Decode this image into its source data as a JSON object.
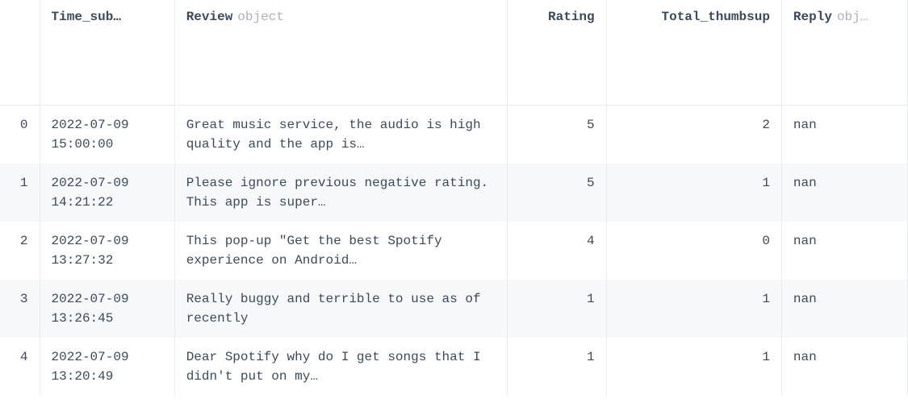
{
  "table": {
    "columns": [
      {
        "label": "Time_sub…",
        "dtype": ""
      },
      {
        "label": "Review",
        "dtype": "object"
      },
      {
        "label": "Rating",
        "dtype": ""
      },
      {
        "label": "Total_thumbsup",
        "dtype": ""
      },
      {
        "label": "Reply",
        "dtype": "obj…"
      }
    ],
    "rows": [
      {
        "idx": "0",
        "time": "2022-07-09 15:00:00",
        "review": "Great music service, the audio is high quality and the app is…",
        "rating": "5",
        "thumbs": "2",
        "reply": "nan"
      },
      {
        "idx": "1",
        "time": "2022-07-09 14:21:22",
        "review": "Please ignore previous negative rating. This app is super…",
        "rating": "5",
        "thumbs": "1",
        "reply": "nan"
      },
      {
        "idx": "2",
        "time": "2022-07-09 13:27:32",
        "review": "This pop-up \"Get the best Spotify experience on Android…",
        "rating": "4",
        "thumbs": "0",
        "reply": "nan"
      },
      {
        "idx": "3",
        "time": "2022-07-09 13:26:45",
        "review": "Really buggy and terrible to use as of recently",
        "rating": "1",
        "thumbs": "1",
        "reply": "nan"
      },
      {
        "idx": "4",
        "time": "2022-07-09 13:20:49",
        "review": "Dear Spotify why do I get songs that I didn't put on my…",
        "rating": "1",
        "thumbs": "1",
        "reply": "nan"
      }
    ]
  }
}
